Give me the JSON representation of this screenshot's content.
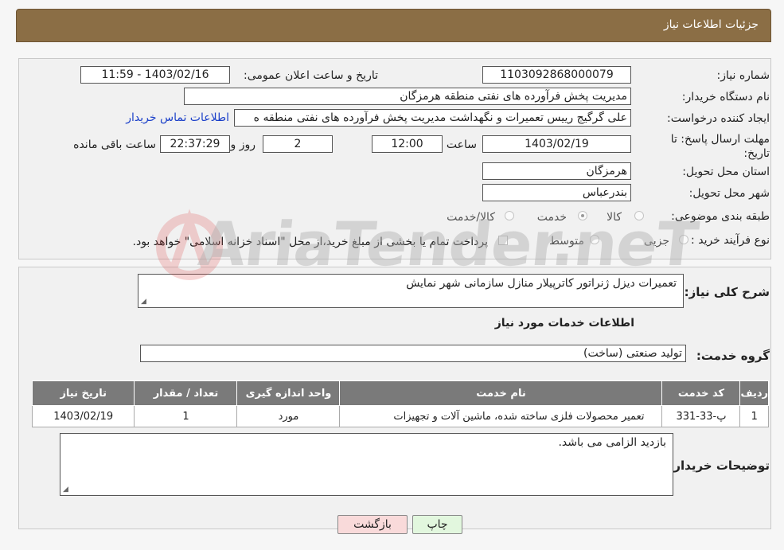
{
  "header": {
    "title": "جزئیات اطلاعات نیاز"
  },
  "form": {
    "need_number_label": "شماره نیاز:",
    "need_number": "1103092868000079",
    "announce_label": "تاریخ و ساعت اعلان عمومی:",
    "announce_value": "1403/02/16 - 11:59",
    "buyer_org_label": "نام دستگاه خریدار:",
    "buyer_org": "مدیریت پخش فرآورده های نفتی منطقه هرمزگان",
    "requester_label": "ایجاد کننده درخواست:",
    "requester": "علی گرگیج رییس تعمیرات و نگهداشت مدیریت پخش فرآورده های نفتی منطقه ه",
    "contact_link": "اطلاعات تماس خریدار",
    "deadline_label": "مهلت ارسال پاسخ: تا تاریخ:",
    "deadline_date": "1403/02/19",
    "time_label": "ساعت",
    "deadline_time": "12:00",
    "days_value": "2",
    "days_label": "روز و",
    "remaining_time": "22:37:29",
    "remaining_label": "ساعت باقی مانده",
    "province_label": "استان محل تحویل:",
    "province": "هرمزگان",
    "city_label": "شهر محل تحویل:",
    "city": "بندرعباس",
    "category_label": "طبقه بندی موضوعی:",
    "category_options": [
      "کالا",
      "خدمت",
      "کالا/خدمت"
    ],
    "category_selected": "خدمت",
    "process_label": "نوع فرآیند خرید :",
    "process_options": [
      "جزیی",
      "متوسط"
    ],
    "payment_note": "پرداخت تمام یا بخشی از مبلغ خرید،از محل \"اسناد خزانه اسلامی\" خواهد بود."
  },
  "summary": {
    "description_label": "شرح کلی نیاز:",
    "description": "تعمیرات دیزل ژنراتور کاترپیلار منازل سازمانی شهر نمایش",
    "services_heading": "اطلاعات خدمات مورد نیاز",
    "service_group_label": "گروه خدمت:",
    "service_group": "تولید صنعتی (ساخت)"
  },
  "table": {
    "columns": [
      "ردیف",
      "کد خدمت",
      "نام خدمت",
      "واحد اندازه گیری",
      "تعداد / مقدار",
      "تاریخ نیاز"
    ],
    "rows": [
      [
        "1",
        "پ-33-331",
        "تعمیر محصولات فلزی ساخته شده، ماشین آلات و تجهیزات",
        "مورد",
        "1",
        "1403/02/19"
      ]
    ]
  },
  "buyer_notes": {
    "label": "توضیحات خریدار:",
    "text": "بازدید الزامی می باشد."
  },
  "buttons": {
    "print": "چاپ",
    "back": "بازگشت"
  },
  "watermark": {
    "text": "AriaTender.neT"
  },
  "colors": {
    "header_bg": "#8b6e45",
    "table_header_bg": "#7a7a7a",
    "link": "#1a3fc9",
    "back_button_bg": "#f9dada",
    "print_button_bg": "#e2f7de"
  }
}
